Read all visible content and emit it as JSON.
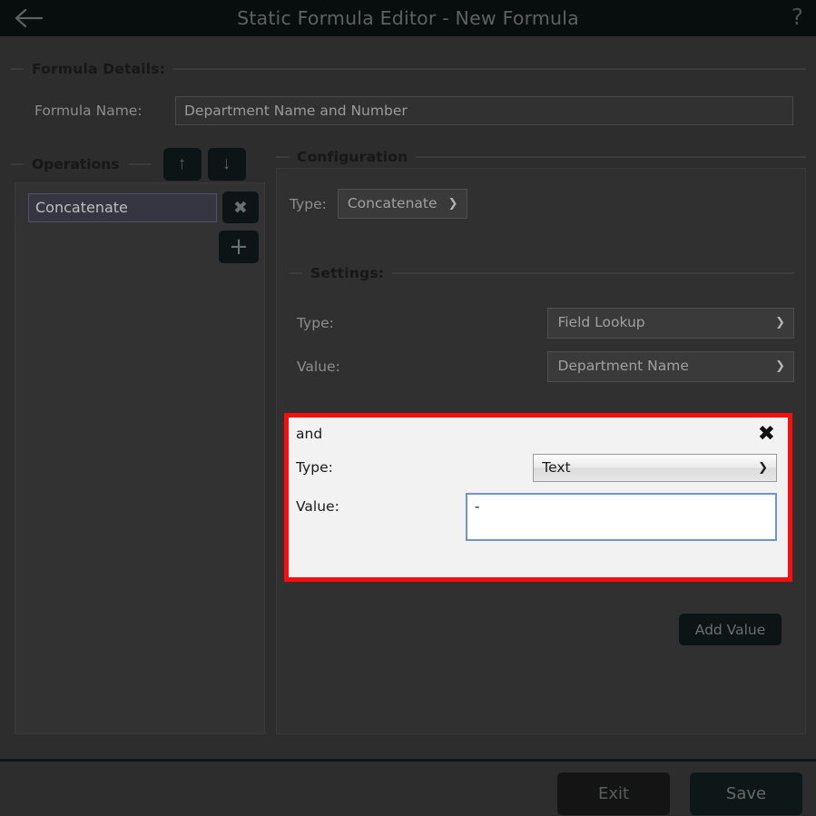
{
  "window": {
    "title": "Static Formula Editor - New Formula",
    "back_icon": "back-arrow-icon",
    "help_icon": "?"
  },
  "formula_details": {
    "group_title": "Formula Details:",
    "name_label": "Formula Name:",
    "name_value": "Department Name and Number"
  },
  "operations": {
    "group_title": "Operations",
    "move_up_icon": "↑",
    "move_down_icon": "↓",
    "remove_icon": "✖",
    "add_icon": "+",
    "items": [
      {
        "label": "Concatenate",
        "selected": true
      }
    ]
  },
  "configuration": {
    "group_title": "Configuration",
    "type_label": "Type:",
    "type_value": "Concatenate",
    "settings": {
      "group_title": "Settings:",
      "rows": [
        {
          "label": "Type:",
          "value": "Field Lookup"
        },
        {
          "label": "Value:",
          "value": "Department Name"
        }
      ]
    },
    "value_card": {
      "conjunction": "and",
      "close_icon": "✖",
      "type_label": "Type:",
      "type_value": "Text",
      "value_label": "Value:",
      "value_text": "-",
      "highlight_color": "#fb0d0d"
    },
    "add_value_label": "Add Value"
  },
  "footer": {
    "exit_label": "Exit",
    "save_label": "Save"
  },
  "chevron": "❯"
}
